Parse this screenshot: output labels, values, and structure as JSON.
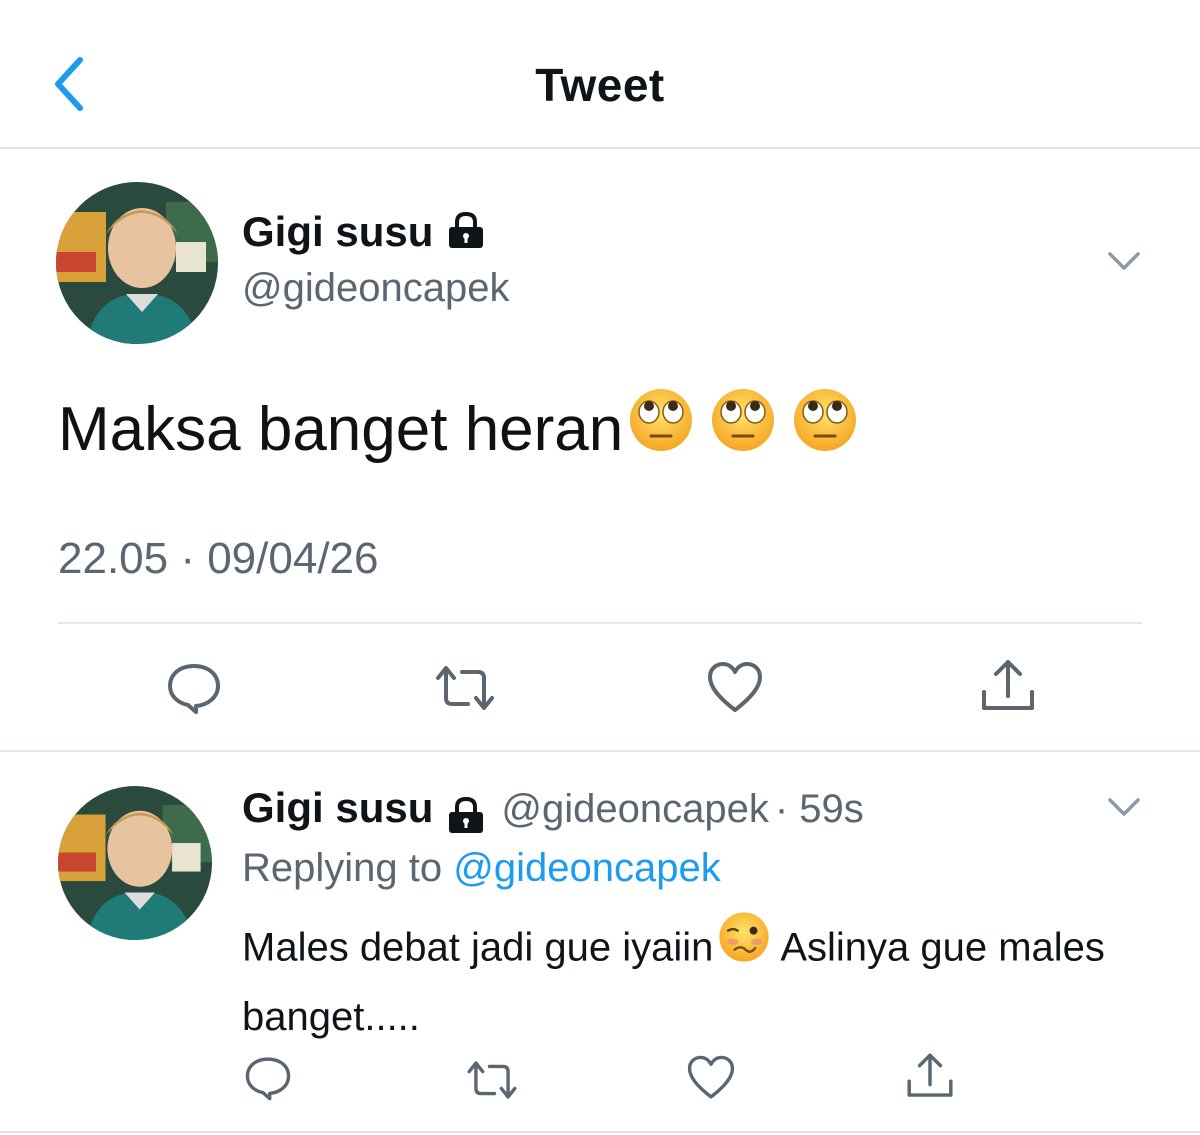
{
  "header": {
    "title": "Tweet",
    "back_icon": "chevron-left-icon",
    "accent": "#1d9bf0"
  },
  "tweet": {
    "display_name": "Gigi susu",
    "handle": "@gideoncapek",
    "protected_icon": "lock-icon",
    "text": "Maksa banget heran",
    "emojis": [
      "face-with-rolling-eyes",
      "face-with-rolling-eyes",
      "face-with-rolling-eyes"
    ],
    "timestamp": "22.05 · 09/04/26",
    "actions": [
      "reply-icon",
      "retweet-icon",
      "like-icon",
      "share-icon"
    ]
  },
  "reply": {
    "display_name": "Gigi susu",
    "handle": "@gideoncapek",
    "time": "· 59s",
    "replying_prefix": "Replying to ",
    "replying_to": "@gideoncapek",
    "text_part1": "Males debat jadi gue iyaiin",
    "emoji": "woozy-face",
    "text_part2": " Aslinya gue males banget.....",
    "actions": [
      "reply-icon",
      "retweet-icon",
      "like-icon",
      "share-icon"
    ]
  }
}
